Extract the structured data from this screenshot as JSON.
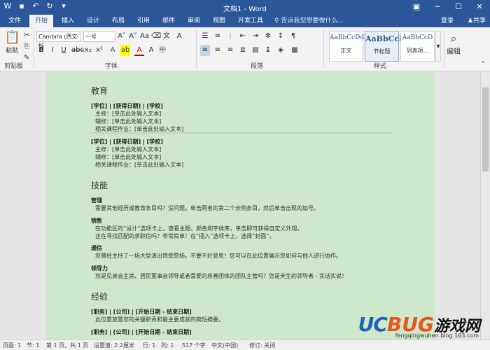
{
  "app": {
    "title": "文档1 - Word",
    "tabs": [
      "文件",
      "开始",
      "插入",
      "设计",
      "布局",
      "引用",
      "邮件",
      "审阅",
      "视图",
      "开发工具"
    ],
    "tell_me": "告诉我您想要做什么...",
    "signin": "登录",
    "share": "共享"
  },
  "ribbon": {
    "paste": "粘贴",
    "groups": [
      "剪贴板",
      "字体",
      "段落",
      "样式",
      "编辑"
    ],
    "font_name": "Cambria (西文标",
    "font_size": "一号",
    "styles": [
      {
        "sample": "AaBbCcDdl",
        "name": "正文"
      },
      {
        "sample": "AaBbCcl",
        "name": "节标题"
      },
      {
        "sample": "AaBbCcD",
        "name": "列表项..."
      }
    ],
    "edit": "编辑"
  },
  "doc": {
    "education_title": "教育",
    "edu1_header": "[学位] | [获得日期] | [学校]",
    "edu_major": "主修：[单击此处输入文本]",
    "edu_minor": "辅修：[单击此处输入文本]",
    "edu_courses": "相关课程作业：[单击此处输入文本]",
    "edu2_header": "[学位] | [获得日期] | [学校]",
    "skills_title": "技能",
    "skill1_title": "管理",
    "skill1_text": "需要其他经历或教育条目吗？没问题。单击两者的第二个示例条目，然后单击出现的加号。",
    "skill2_title": "销售",
    "skill2_text1": "在功能区的“设计”选项卡上，查看主题、颜色和字体库，单击即可获得自定义外观。",
    "skill2_text2": "正在寻找匹配的求职信吗？非常简单！在“插入”选项卡上，选择“封面”。",
    "skill3_title": "通信",
    "skill3_text": "您曾经主持了一场大型演出饱受赞扬。不要不好意思！您可以在此位置展示您如何与他人进行协作。",
    "skill4_title": "领导力",
    "skill4_text": "您是见弟会主席、居民董事会领导或者喜爱的慈善团体的团队主管吗？您是天生的领导者 - 实话实说！",
    "exp_title": "经验",
    "exp1_header": "[职务] | [公司] | [开始日期 - 结束日期]",
    "exp1_text": "此位置放置您的关键职责和最主要成就的简短摘要。",
    "exp2_header": "[职务] | [公司] | [开始日期 - 结束日期]"
  },
  "watermark": {
    "brand_uc": "UC",
    "brand_bug": "BUG",
    "brand_cn": "游戏网",
    "url": "fengqingwuhen.blog.163.com"
  },
  "status": {
    "page": "页面: 1",
    "section": "节: 1",
    "page_of": "第 1 页，共 1 页",
    "position": "设置值: 2.2厘米",
    "row": "行: 1",
    "col": "列: 1",
    "words": "517 个字",
    "lang": "中文(中国)",
    "track": "修订: 关闭"
  }
}
